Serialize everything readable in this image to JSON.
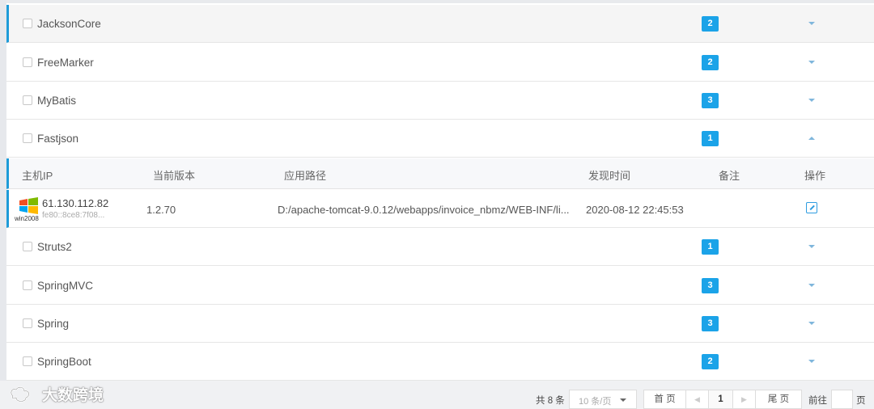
{
  "libraries": [
    {
      "name": "JacksonCore",
      "count": "2",
      "expanded": false,
      "active": true
    },
    {
      "name": "FreeMarker",
      "count": "2",
      "expanded": false
    },
    {
      "name": "MyBatis",
      "count": "3",
      "expanded": false
    },
    {
      "name": "Fastjson",
      "count": "1",
      "expanded": true
    },
    {
      "name": "Struts2",
      "count": "1",
      "expanded": false
    },
    {
      "name": "SpringMVC",
      "count": "3",
      "expanded": false
    },
    {
      "name": "Spring",
      "count": "3",
      "expanded": false
    },
    {
      "name": "SpringBoot",
      "count": "2",
      "expanded": false
    }
  ],
  "detail": {
    "headers": {
      "host_ip": "主机IP",
      "version": "当前版本",
      "path": "应用路径",
      "found_time": "发现时间",
      "remark": "备注",
      "action": "操作"
    },
    "row": {
      "os": "win2008",
      "ip": "61.130.112.82",
      "ipv6": "fe80::8ce8:7f08...",
      "version": "1.2.70",
      "path": "D:/apache-tomcat-9.0.12/webapps/invoice_nbmz/WEB-INF/li...",
      "found_time": "2020-08-12 22:45:53",
      "remark": "",
      "action_icon": "edit-icon"
    }
  },
  "footer": {
    "watermark": "大数跨境",
    "total": "共 8 条",
    "page_size": "10 条/页",
    "first": "首 页",
    "prev": "◀",
    "current_page": "1",
    "next": "▶",
    "last": "尾 页",
    "goto_label": "前往",
    "goto_value": "",
    "goto_suffix": "页"
  },
  "colors": {
    "accent": "#1d9bd8",
    "badge": "#1ba3e8"
  }
}
